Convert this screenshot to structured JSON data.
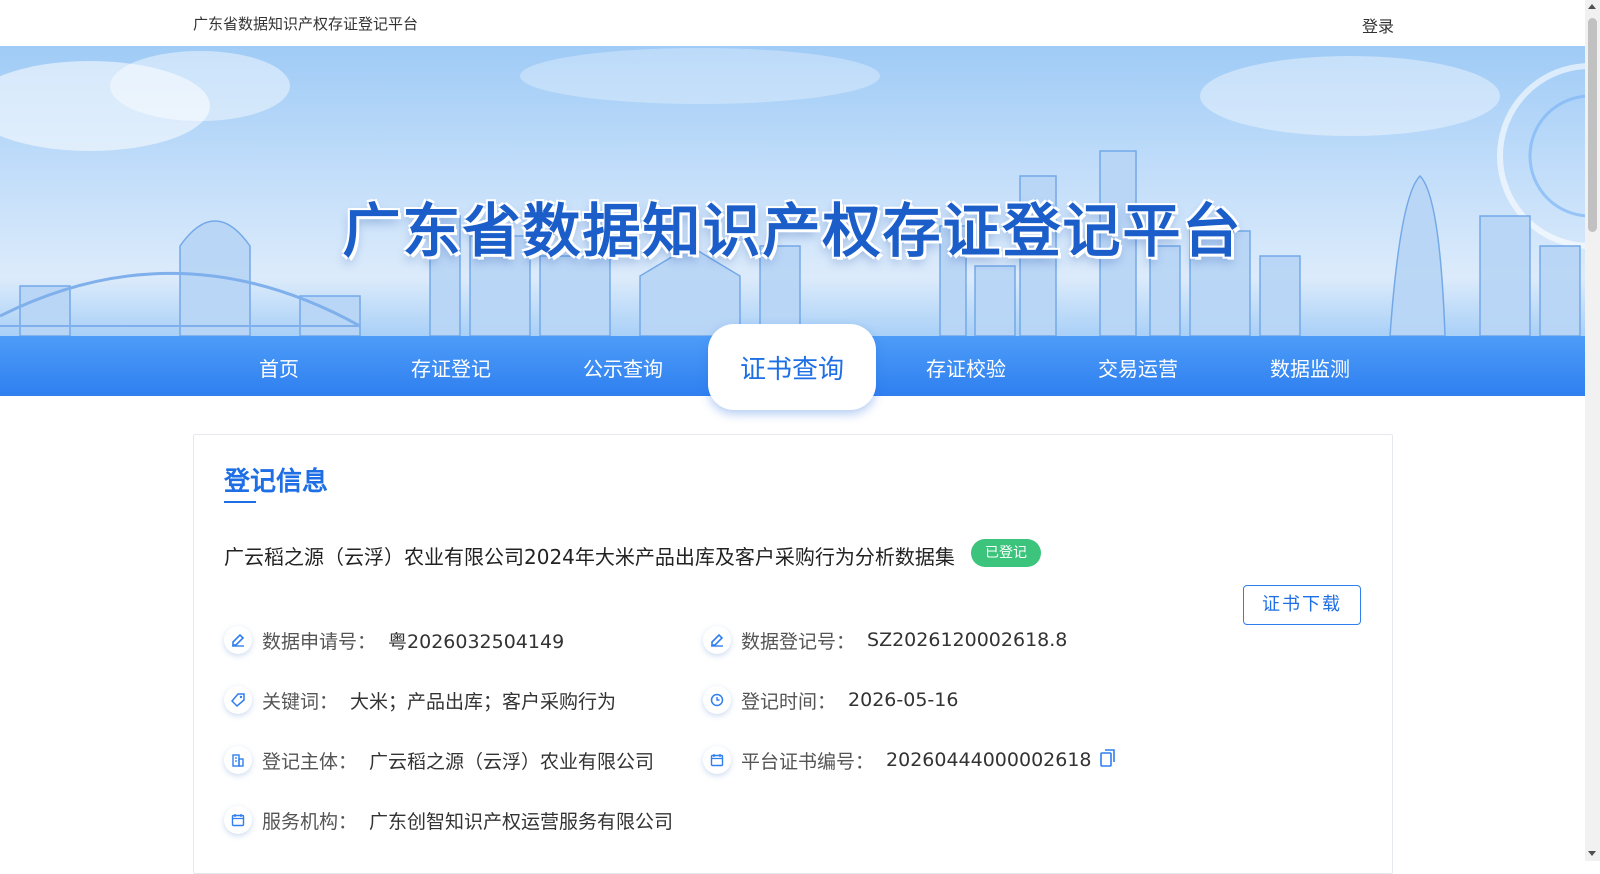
{
  "header": {
    "site_title": "广东省数据知识产权存证登记平台",
    "login": "登录"
  },
  "banner": {
    "title": "广东省数据知识产权存证登记平台"
  },
  "nav": {
    "items": [
      "首页",
      "存证登记",
      "公示查询",
      "证书查询",
      "存证校验",
      "交易运营",
      "数据监测"
    ],
    "active": "证书查询"
  },
  "card": {
    "section_title": "登记信息",
    "dataset_name": "广云稻之源（云浮）农业有限公司2024年大米产品出库及客户采购行为分析数据集",
    "status": "已登记",
    "download_label": "证书下载",
    "fields": {
      "apply_no": {
        "label": "数据申请号：",
        "value": "粤2026032504149"
      },
      "register_no": {
        "label": "数据登记号：",
        "value": "SZ2026120002618.8"
      },
      "keywords": {
        "label": "关键词：",
        "value": "大米；产品出库；客户采购行为"
      },
      "register_time": {
        "label": "登记时间：",
        "value": "2026-05-16"
      },
      "subject": {
        "label": "登记主体：",
        "value": "广云稻之源（云浮）农业有限公司"
      },
      "cert_no": {
        "label": "平台证书编号：",
        "value": "20260444000002618"
      },
      "agency": {
        "label": "服务机构：",
        "value": "广东创智知识产权运营服务有限公司"
      }
    }
  },
  "colors": {
    "primary": "#1e6fe6",
    "nav_bg": "#3b8af4",
    "badge": "#3cc47c"
  },
  "icons": [
    "edit-icon",
    "tag-icon",
    "clock-icon",
    "company-icon",
    "calendar-icon",
    "copy-icon"
  ]
}
